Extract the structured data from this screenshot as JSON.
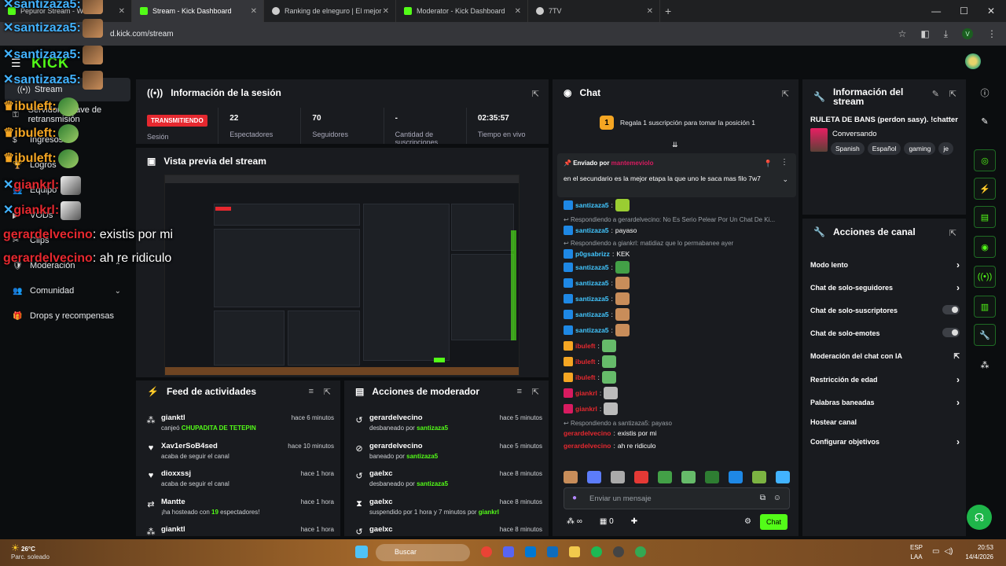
{
  "browser": {
    "tabs": [
      {
        "label": "Pepuror Stream - W",
        "active": false
      },
      {
        "label": "Stream - Kick Dashboard",
        "active": true
      },
      {
        "label": "Ranking de elneguro | El mejor",
        "active": false
      },
      {
        "label": "Moderator - Kick Dashboard",
        "active": false
      },
      {
        "label": "7TV",
        "active": false
      }
    ],
    "url": "d.kick.com/stream",
    "profile_initial": "V"
  },
  "kick": {
    "logo": "KICK"
  },
  "sidebar": {
    "items": [
      {
        "label": "Stream",
        "icon": "broadcast-icon"
      },
      {
        "label": "Servidor y clave de retransmisión",
        "icon": "key-icon"
      },
      {
        "label": "Ingresos",
        "icon": "money-icon"
      },
      {
        "label": "Logros",
        "icon": "trophy-icon"
      },
      {
        "label": "Equipo",
        "icon": "team-icon"
      },
      {
        "label": "VODs",
        "icon": "vod-icon"
      },
      {
        "label": "Clips",
        "icon": "clip-icon"
      },
      {
        "label": "Moderación",
        "icon": "shield-icon"
      },
      {
        "label": "Comunidad",
        "icon": "community-icon"
      },
      {
        "label": "Drops y recompensas",
        "icon": "gift-icon"
      }
    ]
  },
  "session": {
    "title": "Información de la sesión",
    "badge": "TRANSMITIENDO",
    "badge_label": "Sesión",
    "stats": [
      {
        "value": "22",
        "label": "Espectadores"
      },
      {
        "value": "70",
        "label": "Seguidores"
      },
      {
        "value": "-",
        "label": "Cantidad de suscripciones"
      },
      {
        "value": "02:35:57",
        "label": "Tiempo en vivo"
      }
    ]
  },
  "preview": {
    "title": "Vista previa del stream"
  },
  "feed": {
    "title": "Feed de actividades",
    "rows": [
      {
        "name": "gianktl",
        "pre": "canjeó ",
        "hl": "CHUPADITA DE TETEPIN",
        "post": "",
        "time": "hace 6 minutos",
        "icon": "points-icon"
      },
      {
        "name": "Xav1erSoB4sed",
        "pre": "acaba de seguir el canal",
        "hl": "",
        "post": "",
        "time": "hace 10 minutos",
        "icon": "heart-icon"
      },
      {
        "name": "dioxxssj",
        "pre": "acaba de seguir el canal",
        "hl": "",
        "post": "",
        "time": "hace 1 hora",
        "icon": "heart-icon"
      },
      {
        "name": "Mantte",
        "pre": "¡ha hosteado con ",
        "hl": "19",
        "post": " espectadores!",
        "time": "hace 1 hora",
        "icon": "host-icon"
      },
      {
        "name": "gianktl",
        "pre": "",
        "hl": "",
        "post": "",
        "time": "hace 1 hora",
        "icon": "points-icon"
      }
    ]
  },
  "modactions": {
    "title": "Acciones de moderador",
    "rows": [
      {
        "name": "gerardelvecino",
        "pre": "desbaneado por ",
        "hl": "santizaza5",
        "post": "",
        "time": "hace 5 minutos",
        "icon": "undo-icon"
      },
      {
        "name": "gerardelvecino",
        "pre": "baneado por ",
        "hl": "santizaza5",
        "post": "",
        "time": "hace 5 minutos",
        "icon": "ban-icon"
      },
      {
        "name": "gaelxc",
        "pre": "desbaneado por ",
        "hl": "santizaza5",
        "post": "",
        "time": "hace 8 minutos",
        "icon": "undo-icon"
      },
      {
        "name": "gaelxc",
        "pre": "suspendido por 1 hora y 7 minutos por ",
        "hl": "giankrl",
        "post": "",
        "time": "hace 8 minutos",
        "icon": "hourglass-icon"
      },
      {
        "name": "gaelxc",
        "pre": "",
        "hl": "",
        "post": "",
        "time": "hace 8 minutos",
        "icon": "undo-icon"
      }
    ]
  },
  "chat": {
    "title": "Chat",
    "sub_goal": "Regala 1 suscripción para tomar la posición 1",
    "sub_rank": "1",
    "pinned": {
      "sent_by_label": "Enviado por",
      "sent_by_user": "mantemeviolo",
      "text": "en el secundario es la mejor etapa la que uno le saca mas filo 7w7"
    },
    "messages": [
      {
        "type": "msg",
        "user": "santizaza5",
        "color": "blue",
        "badge": "blue",
        "text": "",
        "emote": "#9acd32"
      },
      {
        "type": "reply",
        "text": "Respondiendo a gerardelvecino: No Es Serio Pelear Por Un Chat De Ki..."
      },
      {
        "type": "msg",
        "user": "santizaza5",
        "color": "blue",
        "badge": "blue",
        "text": "payaso",
        "emote": ""
      },
      {
        "type": "reply",
        "text": "Respondiendo a giankrl: matidiaz que lo permabanee ayer"
      },
      {
        "type": "msg",
        "user": "p0gsabrizz",
        "color": "blue",
        "badge": "blue",
        "text": "KEK",
        "emote": ""
      },
      {
        "type": "msg",
        "user": "santizaza5",
        "color": "blue",
        "badge": "blue",
        "text": "",
        "emote": "#43a047"
      },
      {
        "type": "msg",
        "user": "santizaza5",
        "color": "blue",
        "badge": "blue",
        "text": "",
        "emote": "#c88d5a"
      },
      {
        "type": "msg",
        "user": "santizaza5",
        "color": "blue",
        "badge": "blue",
        "text": "",
        "emote": "#c88d5a"
      },
      {
        "type": "msg",
        "user": "santizaza5",
        "color": "blue",
        "badge": "blue",
        "text": "",
        "emote": "#c88d5a"
      },
      {
        "type": "msg",
        "user": "santizaza5",
        "color": "blue",
        "badge": "blue",
        "text": "",
        "emote": "#c88d5a"
      },
      {
        "type": "msg",
        "user": "ibuleft",
        "color": "red",
        "badge": "crown",
        "text": "",
        "emote": "#66bb6a"
      },
      {
        "type": "msg",
        "user": "ibuleft",
        "color": "red",
        "badge": "crown",
        "text": "",
        "emote": "#66bb6a"
      },
      {
        "type": "msg",
        "user": "ibuleft",
        "color": "red",
        "badge": "crown",
        "text": "",
        "emote": "#66bb6a"
      },
      {
        "type": "msg",
        "user": "giankrl",
        "color": "red",
        "badge": "pink",
        "text": "",
        "emote": "#bbbbbb"
      },
      {
        "type": "msg",
        "user": "giankrl",
        "color": "red",
        "badge": "pink",
        "text": "",
        "emote": "#bbbbbb"
      },
      {
        "type": "reply",
        "text": "Respondiendo a santizaza5: payaso"
      },
      {
        "type": "msg",
        "user": "gerardelvecino",
        "color": "red",
        "badge": "",
        "text": "existis por mi",
        "emote": ""
      },
      {
        "type": "msg",
        "user": "gerardelvecino",
        "color": "red",
        "badge": "",
        "text": "ah re ridiculo",
        "emote": ""
      }
    ],
    "input_placeholder": "Enviar un mensaje",
    "points": "∞",
    "gifts": "0",
    "send_label": "Chat"
  },
  "streaminfo": {
    "title": "Información del stream",
    "stream_title": "RULETA DE BANS (perdon sasy). !chatter",
    "category": "Conversando",
    "tags": [
      "Spanish",
      "Español",
      "gaming",
      "je"
    ]
  },
  "channelactions": {
    "title": "Acciones de canal",
    "items": [
      {
        "label": "Modo lento",
        "control": "chevron"
      },
      {
        "label": "Chat de solo-seguidores",
        "control": "chevron"
      },
      {
        "label": "Chat de solo-suscriptores",
        "control": "toggle"
      },
      {
        "label": "Chat de solo-emotes",
        "control": "toggle"
      },
      {
        "label": "Moderación del chat con IA",
        "control": "external"
      },
      {
        "label": "Restricción de edad",
        "control": "chevron"
      },
      {
        "label": "Palabras baneadas",
        "control": "chevron"
      },
      {
        "label": "Hostear canal",
        "control": "none"
      },
      {
        "label": "Configurar objetivos",
        "control": "chevron"
      }
    ]
  },
  "overlay": {
    "lines": [
      {
        "user": "santizaza5:",
        "cls": "blue",
        "text": "",
        "emote": "normal"
      },
      {
        "user": "santizaza5:",
        "cls": "blue",
        "text": "",
        "emote": "normal"
      },
      {
        "user": "santizaza5:",
        "cls": "blue",
        "text": "",
        "emote": "normal"
      },
      {
        "user": "santizaza5:",
        "cls": "blue",
        "text": "",
        "emote": "normal"
      },
      {
        "user": "ibuleft:",
        "cls": "gold",
        "text": "",
        "emote": "frog"
      },
      {
        "user": "ibuleft:",
        "cls": "gold",
        "text": "",
        "emote": "frog"
      },
      {
        "user": "ibuleft:",
        "cls": "gold",
        "text": "",
        "emote": "frog"
      },
      {
        "user": "giankrl:",
        "cls": "red",
        "text": "",
        "emote": "grey"
      },
      {
        "user": "giankrl:",
        "cls": "red",
        "text": "",
        "emote": "grey"
      },
      {
        "user": "gerardelvecino",
        "cls": "red",
        "text": ": existis por mi",
        "emote": ""
      },
      {
        "user": "gerardelvecino",
        "cls": "red",
        "text": ": ah re ridiculo",
        "emote": ""
      }
    ]
  },
  "taskbar": {
    "temp": "26°C",
    "weather": "Parc. soleado",
    "search": "Buscar",
    "lang_top": "ESP",
    "lang_bottom": "LAA",
    "time": "20:53",
    "date": "14/4/2026"
  }
}
